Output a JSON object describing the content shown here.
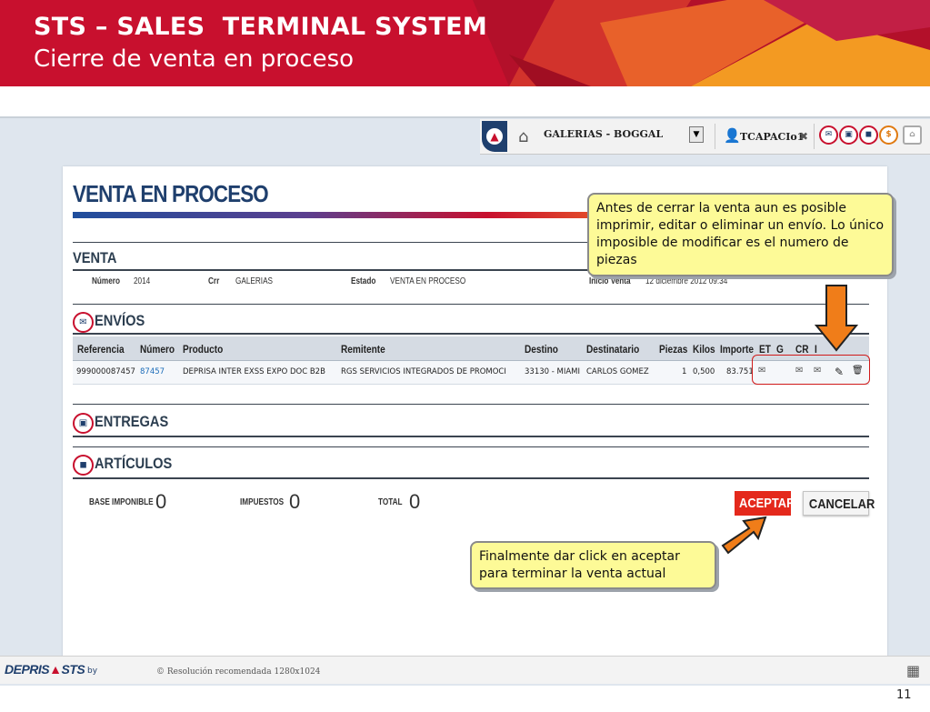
{
  "slide": {
    "title": "STS – SALES  TERMINAL SYSTEM",
    "subtitle": "Cierre de venta en proceso",
    "page_number": "11"
  },
  "topbar": {
    "store": "GALERIAS - BOGGAL",
    "dropdown_glyph": "▼",
    "user": "TCAPACIo1",
    "close_glyph": "✖",
    "icons": [
      "envelope-icon",
      "box-icon",
      "bag-icon",
      "dollar-icon",
      "lock-icon"
    ],
    "icon_glyphs": [
      "✉",
      "▣",
      "◼",
      "$",
      "⌂"
    ]
  },
  "page_title": "VENTA EN PROCESO",
  "venta": {
    "title": "VENTA",
    "numero_label": "Número",
    "numero_value": "2014",
    "crr_label": "Crr",
    "crr_value": "GALERIAS",
    "estado_label": "Estado",
    "estado_value": "VENTA EN PROCESO",
    "inicio_label": "Inicio Venta",
    "inicio_value": "12 diciembre 2012 09:34"
  },
  "envios": {
    "title": "ENVÍOS",
    "columns": [
      "Referencia",
      "Número",
      "Producto",
      "Remitente",
      "Destino",
      "Destinatario",
      "Piezas",
      "Kilos",
      "Importe",
      "ET",
      "G",
      "CR",
      "I"
    ],
    "rows": [
      {
        "referencia": "999000087457",
        "numero": "87457",
        "producto": "DEPRISA INTER EXSS EXPO DOC B2B",
        "remitente": "RGS SERVICIOS INTEGRADOS DE PROMOCI",
        "destino": "33130 - MIAMI",
        "destinatario": "CARLOS GOMEZ",
        "piezas": "1",
        "kilos": "0,500",
        "importe": "83.751"
      }
    ],
    "row_icons": {
      "et": "✉",
      "cr": "✉",
      "i": "✉",
      "edit": "✎",
      "delete": "🗑"
    }
  },
  "entregas": {
    "title": "ENTREGAS"
  },
  "articulos": {
    "title": "ARTÍCULOS"
  },
  "totals": {
    "base_label": "BASE IMPONIBLE",
    "base_value": "0",
    "impuestos_label": "IMPUESTOS",
    "impuestos_value": "0",
    "total_label": "TOTAL",
    "total_value": "0"
  },
  "buttons": {
    "accept": "ACEPTAR",
    "cancel": "CANCELAR"
  },
  "callouts": {
    "edit_note": "Antes de cerrar la venta aun es posible imprimir, editar o eliminar un envío. Lo único imposible de modificar es el numero de piezas",
    "accept_note": "Finalmente dar click en aceptar para terminar la venta actual"
  },
  "footer": {
    "logo_left": "DEPRIS",
    "logo_right": "STS",
    "by": "by",
    "resolution": "© Resolución recomendada 1280x1024"
  },
  "colors": {
    "brand_red": "#c8102e",
    "brand_blue": "#1f3f6d",
    "accept_red": "#e4291c",
    "callout_yellow": "#fdfa97",
    "arrow_orange": "#f07d19"
  }
}
